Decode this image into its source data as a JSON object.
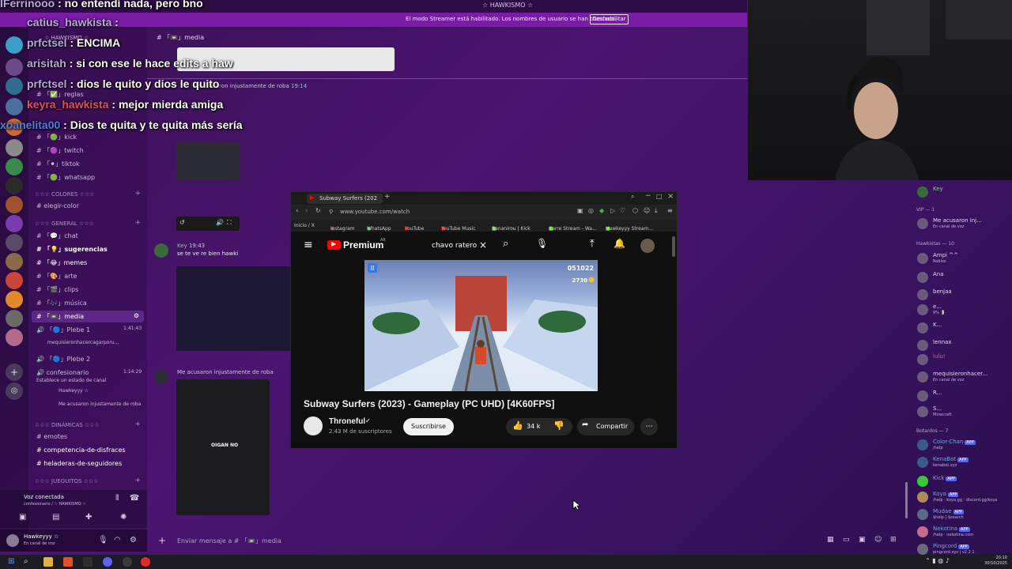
{
  "window": {
    "title": "☆ HAWKISMO ☆"
  },
  "streamer_banner": {
    "text": "El modo Streamer está habilitado. Los nombres de usuario se han truncado.",
    "button": "Deshabilitar"
  },
  "server": {
    "name": "☆ HAWKISMO ☆"
  },
  "channels": {
    "items_top": [
      "reglas",
      "kick",
      "twitch",
      "tiktok",
      "whatsapp"
    ],
    "colores_cat": "☆☆☆ COLORES ☆☆☆",
    "elegir_color": "elegir-color",
    "general_cat": "☆☆☆ GENERAL ☆☆☆",
    "general_items": [
      "chat",
      "sugerencias",
      "memes",
      "arte",
      "clips",
      "música",
      "media"
    ],
    "voice_plebe1": "Plebe 1",
    "voice_plebe1_time": "1:41:43",
    "voice_plebe1_user": "mequisieronhacercagarporu...",
    "voice_plebe2": "Plebe 2",
    "voice_confesionario": "confesionario",
    "voice_confesionario_time": "1:14:29",
    "voice_confesionario_status": "Establece un estado de canal",
    "voice_conf_user1": "Hawkeyyy ☆",
    "voice_conf_user2": "Me acusaron injustamente de roba",
    "dinamicas_cat": "☆☆☆ DINÁMICAS ☆☆☆",
    "dinamicas_items": [
      "emotes",
      "competencia-de-disfraces",
      "heladeras-de-seguidores"
    ],
    "juegos_cat": "☆☆☆ JUEGUITOS ☆☆☆"
  },
  "voice_panel": {
    "status": "Voz conectada",
    "location": "confesionario / ☆ HAWKISMO ☆"
  },
  "user_panel": {
    "name": "Hawkeyyy ☆",
    "status": "En canal de voz"
  },
  "chat": {
    "channel": "media",
    "header": "# 「📼」media",
    "msg1_author": "Me acusaron injustamente de roba",
    "msg1_time": "19:14",
    "msg2_author": "Key",
    "msg2_time": "19:43",
    "msg2_text": "se te ve re bien hawki",
    "msg3_author": "Me acusaron injustamente de roba",
    "msg3_time": "",
    "input_placeholder": "Enviar mensaje a # 「📼」media",
    "embed_caption": "OIGAN NO"
  },
  "twitch_chat": [
    {
      "user": "IFerrinooo",
      "text": ": no entendí nada, pero bno"
    },
    {
      "user": "catius_hawkista",
      "text": ":"
    },
    {
      "user": "prfctsel",
      "text": ": ENCIMA"
    },
    {
      "user": "arisitah",
      "text": ": si con ese le hace edits a haw"
    },
    {
      "user": "prfctsel",
      "text": ": dios le quito y dios le quito"
    },
    {
      "user": "keyra_hawkista",
      "text": ": mejor mierda amiga"
    },
    {
      "user": "xoanelita00",
      "text": ": Dios te quita y te quita más sería"
    }
  ],
  "members": {
    "top": {
      "name": "Key",
      "sub": ""
    },
    "vip_header": "VIP — 1",
    "vip": [
      {
        "name": "Me acusaron inj...",
        "sub": "En canal de voz"
      }
    ],
    "hawk_header": "Hawkistas — 10",
    "hawk": [
      {
        "name": "Ampi ^^",
        "sub": "Roblox"
      },
      {
        "name": "Ana",
        "sub": ""
      },
      {
        "name": "benjaa",
        "sub": ""
      },
      {
        "name": "e...",
        "sub": "9% 🔋"
      },
      {
        "name": "K...",
        "sub": ""
      },
      {
        "name": "lennax",
        "sub": ""
      },
      {
        "name": "lulu!",
        "sub": ""
      },
      {
        "name": "mequisieronhacer...",
        "sub": "En canal de voz"
      },
      {
        "name": "R...",
        "sub": ""
      },
      {
        "name": "S...",
        "sub": "Minecraft"
      }
    ],
    "bots_header": "Botardos — 7",
    "bots": [
      {
        "name": "Color-Chan",
        "sub": "/help"
      },
      {
        "name": "KenaBot",
        "sub": "kenabot.xyz"
      },
      {
        "name": "Kick",
        "sub": ""
      },
      {
        "name": "Koya",
        "sub": "/help · koya.gg · discord.gg/koya"
      },
      {
        "name": "Mudae",
        "sub": "$help | $search"
      },
      {
        "name": "Nekotina",
        "sub": "/help · nekotina.com"
      },
      {
        "name": "Pingcord",
        "sub": "pingcord.xyz | v2.2.1"
      }
    ],
    "app_tag": "APP"
  },
  "browser": {
    "tab_title": "Subway Surfers (202",
    "url": "www.youtube.com/watch",
    "bookmarks": [
      "Inicio / X",
      "Instagram",
      "WhatsApp",
      "YouTube",
      "YouTube Music",
      "Bananirou | Kick",
      "Carre Stream - Wa...",
      "Hawkeyyy Stream..."
    ],
    "brand": "Premium",
    "brand_region": "AR",
    "search_query": "chavo ratero",
    "video_title": "Subway Surfers (2023) - Gameplay (PC UHD) [4K60FPS]",
    "channel_name": "Throneful",
    "subscribers": "2.43 M de suscriptores",
    "subscribe_label": "Suscribirse",
    "likes": "34 k",
    "share_label": "Compartir",
    "game_score": "051022",
    "game_coins": "2730"
  },
  "taskbar": {
    "time": "20:10",
    "date": "30/10/2025"
  },
  "colors": {
    "accent": "#7b1ca6",
    "yt_red": "#ff0000",
    "discord_blurple": "#5865f2"
  }
}
